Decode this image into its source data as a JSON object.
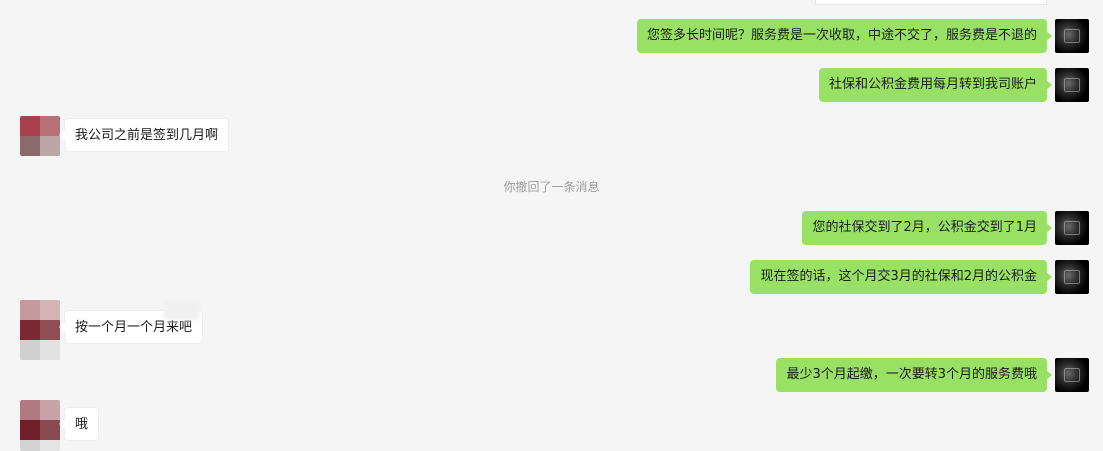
{
  "messages": [
    {
      "from": "self",
      "text": "您签多长时间呢？服务费是一次收取，中途不交了，服务费是不退的"
    },
    {
      "from": "self",
      "text": "社保和公积金费用每月转到我司账户"
    },
    {
      "from": "other",
      "text": "我公司之前是签到几月啊"
    },
    {
      "from": "system",
      "text": "你撤回了一条消息"
    },
    {
      "from": "self",
      "text": "您的社保交到了2月，公积金交到了1月"
    },
    {
      "from": "self",
      "text": "现在签的话，这个月交3月的社保和2月的公积金"
    },
    {
      "from": "other",
      "text": "按一个月一个月来吧"
    },
    {
      "from": "self",
      "text": "最少3个月起缴，一次要转3个月的服务费哦"
    },
    {
      "from": "other",
      "text": "哦"
    }
  ],
  "colors": {
    "background": "#f5f5f5",
    "self_bubble": "#98e165",
    "other_bubble": "#ffffff",
    "system_text": "#9e9e9e"
  },
  "icons": {
    "self_avatar": "dark-photo-avatar",
    "other_avatar": "pixelated-avatar"
  }
}
